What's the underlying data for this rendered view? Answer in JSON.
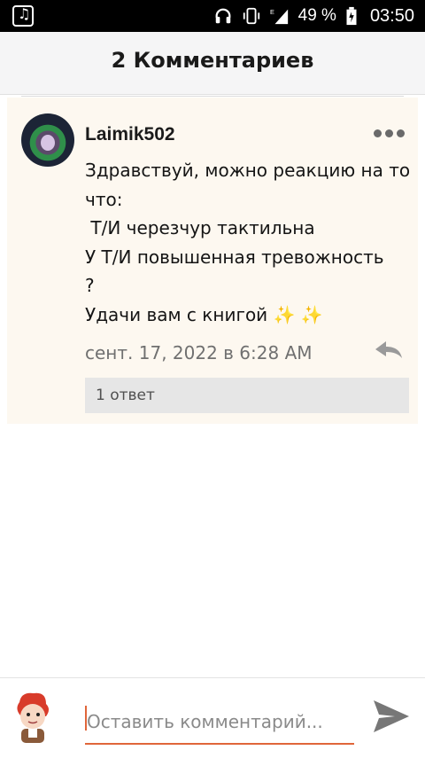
{
  "statusbar": {
    "battery_percent": "49 %",
    "time": "03:50"
  },
  "header": {
    "title": "2 Комментариев"
  },
  "comment": {
    "username": "Laimik502",
    "lines": [
      "Здравствуй, можно реакцию на то",
      "что:",
      " Т/И черезчур тактильна",
      "У Т/И повышенная тревожность",
      "?",
      "Удачи вам с книгой"
    ],
    "sparkles": "✨ ✨",
    "date": "сент. 17, 2022 в 6:28 AM",
    "replies_label": "1 ответ"
  },
  "composer": {
    "placeholder": "Оставить комментарий..."
  },
  "colors": {
    "accent": "#e0663a",
    "card_bg": "#fdf8f0",
    "sparkle": "#f2c230"
  }
}
